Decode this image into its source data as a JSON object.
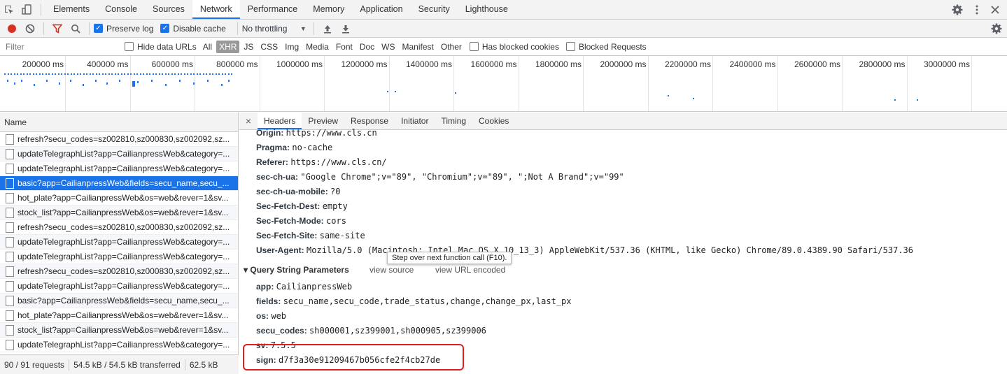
{
  "tabs": [
    "Elements",
    "Console",
    "Sources",
    "Network",
    "Performance",
    "Memory",
    "Application",
    "Security",
    "Lighthouse"
  ],
  "active_tab": "Network",
  "toolbar": {
    "preserve_log": "Preserve log",
    "disable_cache": "Disable cache",
    "throttling": "No throttling"
  },
  "filter": {
    "placeholder": "Filter",
    "hide_data_urls": "Hide data URLs",
    "types": [
      "All",
      "XHR",
      "JS",
      "CSS",
      "Img",
      "Media",
      "Font",
      "Doc",
      "WS",
      "Manifest",
      "Other"
    ],
    "selected_type": "XHR",
    "has_blocked_cookies": "Has blocked cookies",
    "blocked_requests": "Blocked Requests"
  },
  "timeline": {
    "ticks": [
      "200000 ms",
      "400000 ms",
      "600000 ms",
      "800000 ms",
      "1000000 ms",
      "1200000 ms",
      "1400000 ms",
      "1600000 ms",
      "1800000 ms",
      "2000000 ms",
      "2200000 ms",
      "2400000 ms",
      "2600000 ms",
      "2800000 ms",
      "3000000 ms",
      "3200"
    ]
  },
  "requests": {
    "header": "Name",
    "rows": [
      "refresh?secu_codes=sz002810,sz000830,sz002092,sz...",
      "updateTelegraphList?app=CailianpressWeb&category=...",
      "updateTelegraphList?app=CailianpressWeb&category=...",
      "basic?app=CailianpressWeb&fields=secu_name,secu_...",
      "hot_plate?app=CailianpressWeb&os=web&rever=1&sv...",
      "stock_list?app=CailianpressWeb&os=web&rever=1&sv...",
      "refresh?secu_codes=sz002810,sz000830,sz002092,sz...",
      "updateTelegraphList?app=CailianpressWeb&category=...",
      "updateTelegraphList?app=CailianpressWeb&category=...",
      "refresh?secu_codes=sz002810,sz000830,sz002092,sz...",
      "updateTelegraphList?app=CailianpressWeb&category=...",
      "basic?app=CailianpressWeb&fields=secu_name,secu_...",
      "hot_plate?app=CailianpressWeb&os=web&rever=1&sv...",
      "stock_list?app=CailianpressWeb&os=web&rever=1&sv...",
      "updateTelegraphList?app=CailianpressWeb&category=..."
    ]
  },
  "status_bar": {
    "requests": "90 / 91 requests",
    "transferred": "54.5 kB / 54.5 kB transferred",
    "resources": "62.5 kB"
  },
  "detail_tabs": [
    "Headers",
    "Preview",
    "Response",
    "Initiator",
    "Timing",
    "Cookies"
  ],
  "active_detail_tab": "Headers",
  "request_headers": [
    {
      "k": "Origin:",
      "v": "https://www.cls.cn"
    },
    {
      "k": "Pragma:",
      "v": "no-cache"
    },
    {
      "k": "Referer:",
      "v": "https://www.cls.cn/"
    },
    {
      "k": "sec-ch-ua:",
      "v": "\"Google Chrome\";v=\"89\", \"Chromium\";v=\"89\", \";Not A Brand\";v=\"99\""
    },
    {
      "k": "sec-ch-ua-mobile:",
      "v": "?0"
    },
    {
      "k": "Sec-Fetch-Dest:",
      "v": "empty"
    },
    {
      "k": "Sec-Fetch-Mode:",
      "v": "cors"
    },
    {
      "k": "Sec-Fetch-Site:",
      "v": "same-site"
    },
    {
      "k": "User-Agent:",
      "v": "Mozilla/5.0 (Macintosh; Intel Mac OS X 10_13_3) AppleWebKit/537.36 (KHTML, like Gecko) Chrome/89.0.4389.90 Safari/537.36"
    }
  ],
  "query": {
    "title": "Query String Parameters",
    "view_source": "view source",
    "view_url_encoded": "view URL encoded",
    "params": [
      {
        "k": "app:",
        "v": "CailianpressWeb"
      },
      {
        "k": "fields:",
        "v": "secu_name,secu_code,trade_status,change,change_px,last_px"
      },
      {
        "k": "os:",
        "v": "web"
      },
      {
        "k": "secu_codes:",
        "v": "sh000001,sz399001,sh000905,sz399006"
      },
      {
        "k": "sv:",
        "v": "7.5.5"
      },
      {
        "k": "sign:",
        "v": "d7f3a30e91209467b056cfe2f4cb27de"
      }
    ]
  },
  "tooltip": "Step over next function call (F10).",
  "colors": {
    "accent": "#1a73e8",
    "highlight_box": "#e02020",
    "record": "#d93025"
  }
}
